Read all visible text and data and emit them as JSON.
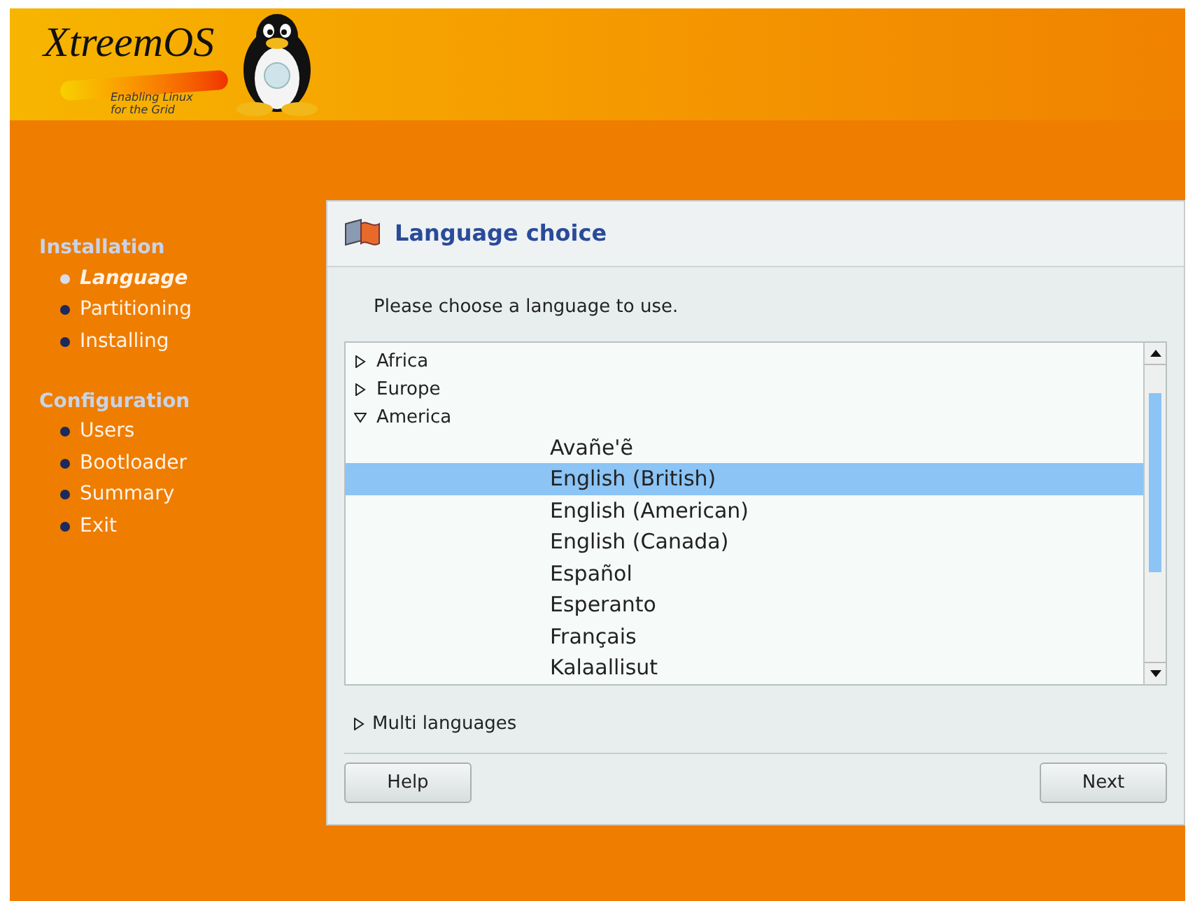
{
  "banner": {
    "logo_text": "XtreemOS",
    "tagline_1": "Enabling Linux",
    "tagline_2": "for the Grid"
  },
  "sidebar": {
    "sections": [
      {
        "title": "Installation",
        "items": [
          {
            "label": "Language",
            "selected": true
          },
          {
            "label": "Partitioning",
            "selected": false
          },
          {
            "label": "Installing",
            "selected": false
          }
        ]
      },
      {
        "title": "Configuration",
        "items": [
          {
            "label": "Users",
            "selected": false
          },
          {
            "label": "Bootloader",
            "selected": false
          },
          {
            "label": "Summary",
            "selected": false
          },
          {
            "label": "Exit",
            "selected": false
          }
        ]
      }
    ]
  },
  "panel": {
    "title": "Language choice",
    "prompt": "Please choose a language to use.",
    "tree": [
      {
        "label": "Africa",
        "expanded": false
      },
      {
        "label": "Europe",
        "expanded": false
      },
      {
        "label": "America",
        "expanded": true,
        "children": [
          {
            "label": "Avañe'ẽ",
            "selected": false
          },
          {
            "label": "English (British)",
            "selected": true
          },
          {
            "label": "English (American)",
            "selected": false
          },
          {
            "label": "English (Canada)",
            "selected": false
          },
          {
            "label": "Español",
            "selected": false
          },
          {
            "label": "Esperanto",
            "selected": false
          },
          {
            "label": "Français",
            "selected": false
          },
          {
            "label": "Kalaallisut",
            "selected": false
          }
        ]
      }
    ],
    "multi_languages": {
      "label": "Multi languages",
      "expanded": false
    },
    "buttons": [
      "Help",
      "Next"
    ]
  }
}
